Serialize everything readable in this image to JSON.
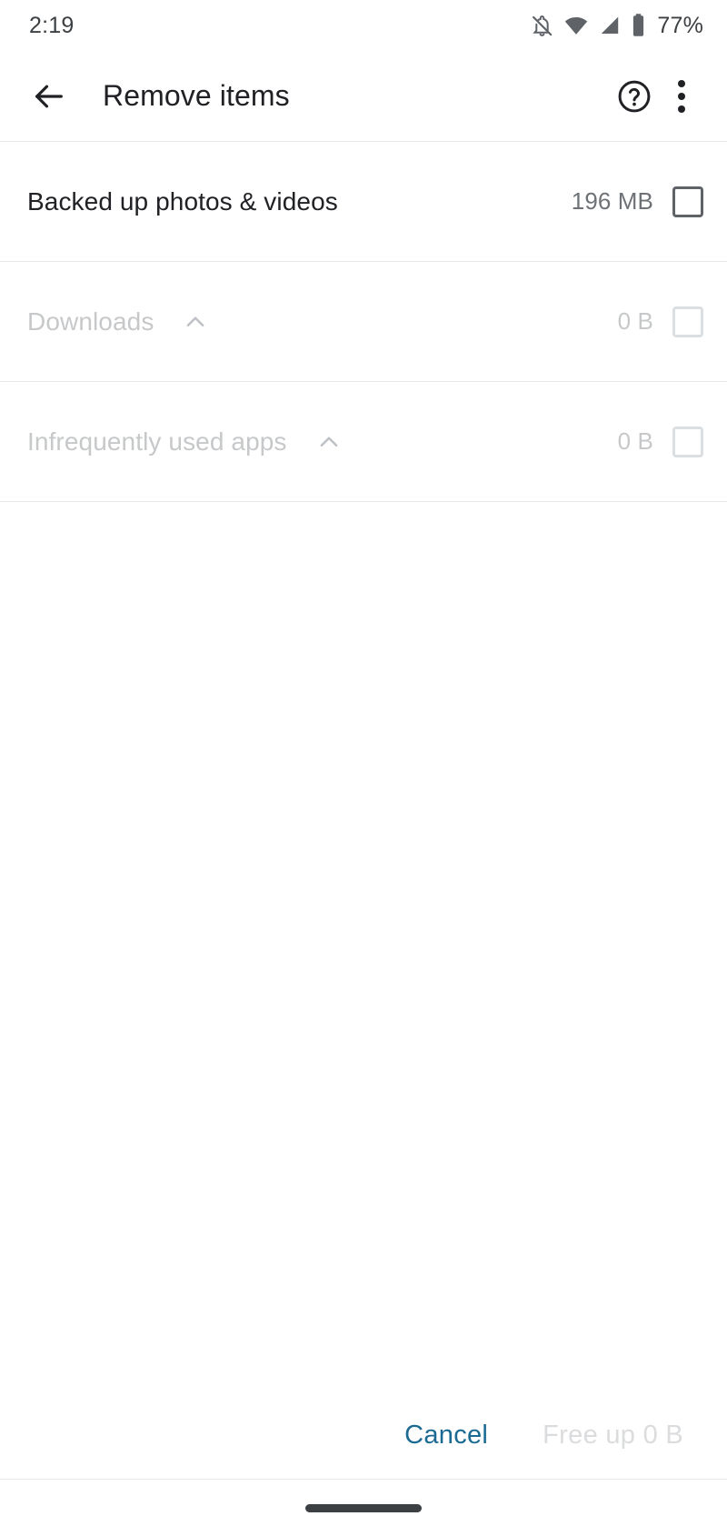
{
  "status_bar": {
    "time": "2:19",
    "battery_percent": "77%",
    "icons": [
      "notifications-off-icon",
      "wifi-icon",
      "cell-signal-icon",
      "battery-icon"
    ]
  },
  "app_bar": {
    "back_icon": "back-arrow-icon",
    "title": "Remove items",
    "help_icon": "help-circle-icon",
    "overflow_icon": "more-vert-icon"
  },
  "list": {
    "rows": [
      {
        "label": "Backed up photos & videos",
        "size": "196 MB",
        "expandable": false,
        "chevron": "",
        "checked": false,
        "disabled": false
      },
      {
        "label": "Downloads",
        "size": "0 B",
        "expandable": true,
        "chevron": "chevron-up-icon",
        "checked": false,
        "disabled": true
      },
      {
        "label": "Infrequently used apps",
        "size": "0 B",
        "expandable": true,
        "chevron": "chevron-up-icon",
        "checked": false,
        "disabled": true
      }
    ]
  },
  "actions": {
    "cancel_label": "Cancel",
    "free_up_label": "Free up 0 B",
    "cancel_color": "#1b6a93",
    "free_up_color": "#dadcde"
  },
  "nav_bar": {
    "home_indicator": "home-gesture-pill"
  }
}
